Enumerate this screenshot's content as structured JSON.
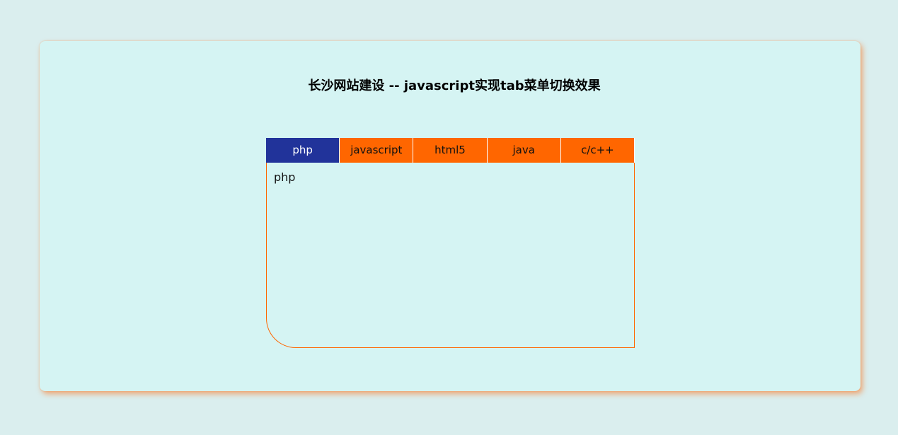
{
  "page": {
    "title": "长沙网站建设 -- javascript实现tab菜单切换效果"
  },
  "tabs": [
    {
      "label": "php",
      "active": true
    },
    {
      "label": "javascript",
      "active": false
    },
    {
      "label": "html5",
      "active": false
    },
    {
      "label": "java",
      "active": false
    },
    {
      "label": "c/c++",
      "active": false
    }
  ],
  "panel": {
    "content": "php"
  },
  "colors": {
    "background": "#daeeee",
    "card": "#d5f4f3",
    "tab_inactive": "#ff6600",
    "tab_active": "#21339a",
    "panel_border": "#ff6600"
  }
}
